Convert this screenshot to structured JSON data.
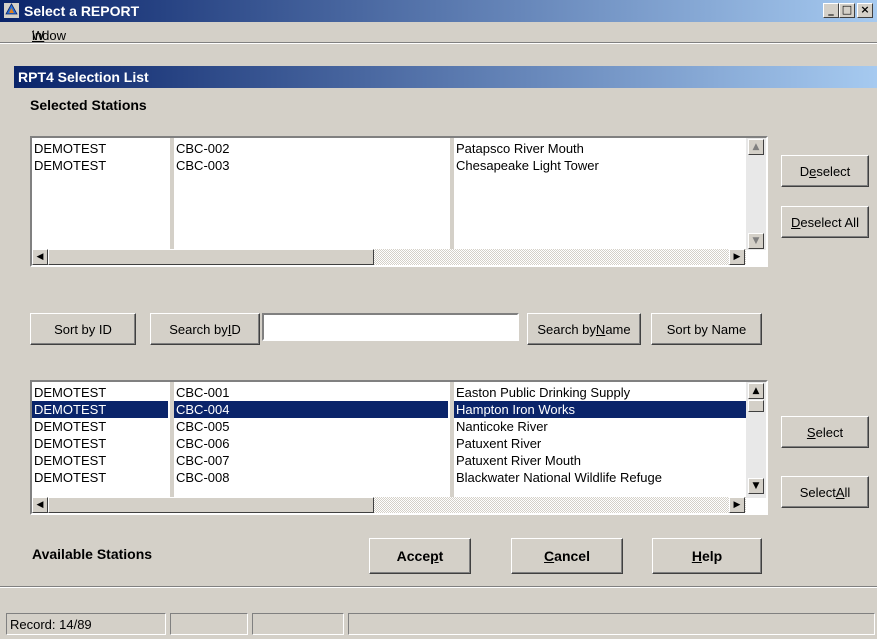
{
  "window": {
    "title": "Select a REPORT",
    "controls": {
      "minimize": "_",
      "maximize": "□",
      "close": "×"
    }
  },
  "menu": {
    "window_prefix": "W",
    "window_rest": "indow"
  },
  "panel": {
    "title": "RPT4 Selection List"
  },
  "selected": {
    "label": "Selected Stations",
    "rows": [
      {
        "owner": "DEMOTEST",
        "id": "CBC-002",
        "name": "Patapsco River Mouth"
      },
      {
        "owner": "DEMOTEST",
        "id": "CBC-003",
        "name": "Chesapeake Light Tower"
      }
    ]
  },
  "buttons": {
    "deselect": {
      "pre": "D",
      "ul": "e",
      "post": "select"
    },
    "deselect_all": {
      "pre": "",
      "ul": "D",
      "post": "eselect All"
    },
    "sort_by_id": "Sort by ID",
    "search_by_id": {
      "pre": "Search by ",
      "ul": "I",
      "post": "D"
    },
    "search_by_name": {
      "pre": "Search by ",
      "ul": "N",
      "post": "ame"
    },
    "sort_by_name": "Sort by Name",
    "select": {
      "pre": "",
      "ul": "S",
      "post": "elect"
    },
    "select_all": {
      "pre": "Select ",
      "ul": "A",
      "post": "ll"
    },
    "accept": {
      "pre": "Acce",
      "ul": "p",
      "post": "t"
    },
    "cancel": {
      "pre": "",
      "ul": "C",
      "post": "ancel"
    },
    "help": {
      "pre": "",
      "ul": "H",
      "post": "elp"
    }
  },
  "search": {
    "value": ""
  },
  "available": {
    "label": "Available Stations",
    "selected_index": 1,
    "rows": [
      {
        "owner": "DEMOTEST",
        "id": "CBC-001",
        "name": "Easton Public Drinking Supply"
      },
      {
        "owner": "DEMOTEST",
        "id": "CBC-004",
        "name": "Hampton Iron Works"
      },
      {
        "owner": "DEMOTEST",
        "id": "CBC-005",
        "name": "Nanticoke River"
      },
      {
        "owner": "DEMOTEST",
        "id": "CBC-006",
        "name": "Patuxent River"
      },
      {
        "owner": "DEMOTEST",
        "id": "CBC-007",
        "name": "Patuxent River Mouth"
      },
      {
        "owner": "DEMOTEST",
        "id": "CBC-008",
        "name": "Blackwater National Wildlife Refuge"
      }
    ]
  },
  "status": {
    "record": "Record: 14/89"
  },
  "colors": {
    "titlebar": "#0a246a",
    "face": "#d4d0c8",
    "selection": "#0a246a"
  }
}
